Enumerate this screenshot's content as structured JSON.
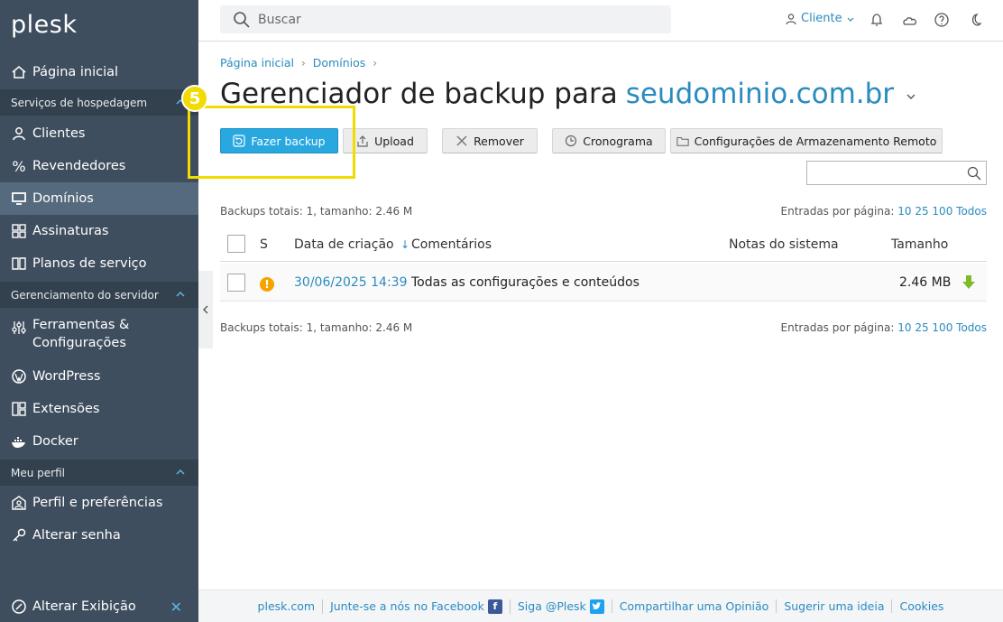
{
  "app": {
    "logo": "plesk"
  },
  "sidebar": {
    "home": "Página inicial",
    "sections": [
      {
        "label": "Serviços de hospedagem"
      },
      {
        "label": "Gerenciamento do servidor"
      },
      {
        "label": "Meu perfil"
      }
    ],
    "items": {
      "clientes": "Clientes",
      "revendedores": "Revendedores",
      "dominios": "Domínios",
      "assinaturas": "Assinaturas",
      "planos": "Planos de serviço",
      "ferramentas_1": "Ferramentas &",
      "ferramentas_2": "Configurações",
      "wordpress": "WordPress",
      "extensoes": "Extensões",
      "docker": "Docker",
      "perfil": "Perfil e preferências",
      "senha": "Alterar senha",
      "exibicao": "Alterar Exibição"
    },
    "active": "Domínios"
  },
  "topbar": {
    "search_placeholder": "Buscar",
    "user_label": "Cliente"
  },
  "breadcrumb": [
    "Página inicial",
    "Domínios"
  ],
  "page": {
    "title_prefix": "Gerenciador de backup para",
    "title_domain": "seudominio.com.br"
  },
  "toolbar": {
    "backup": "Fazer backup",
    "upload": "Upload",
    "remove": "Remover",
    "schedule": "Cronograma",
    "remote_storage": "Configurações de Armazenamento Remoto"
  },
  "annotation": {
    "step": "5"
  },
  "summary": {
    "totals": "Backups totais: 1, tamanho: 2.46 M",
    "per_page_label": "Entradas por página:",
    "per_page_options": [
      "10",
      "25",
      "100",
      "Todos"
    ]
  },
  "table": {
    "columns": {
      "status": "S",
      "date": "Data de criação",
      "comments": "Comentários",
      "system_notes": "Notas do sistema",
      "size": "Tamanho"
    },
    "rows": [
      {
        "date": "30/06/2025 14:39",
        "comment": "Todas as configurações e conteúdos",
        "system_notes": "",
        "size": "2.46 MB"
      }
    ]
  },
  "footer": {
    "links": [
      "plesk.com",
      "Junte-se a nós no Facebook",
      "Siga @Plesk",
      "Compartilhar uma Opinião",
      "Sugerir uma ideia",
      "Cookies"
    ]
  },
  "colors": {
    "sidebar_bg": "#3f4e5e",
    "accent": "#2a8bbf",
    "primary_button": "#29a8e0",
    "highlight": "#f2dc00",
    "warning": "#f5a300",
    "download": "#7dbb2a"
  }
}
